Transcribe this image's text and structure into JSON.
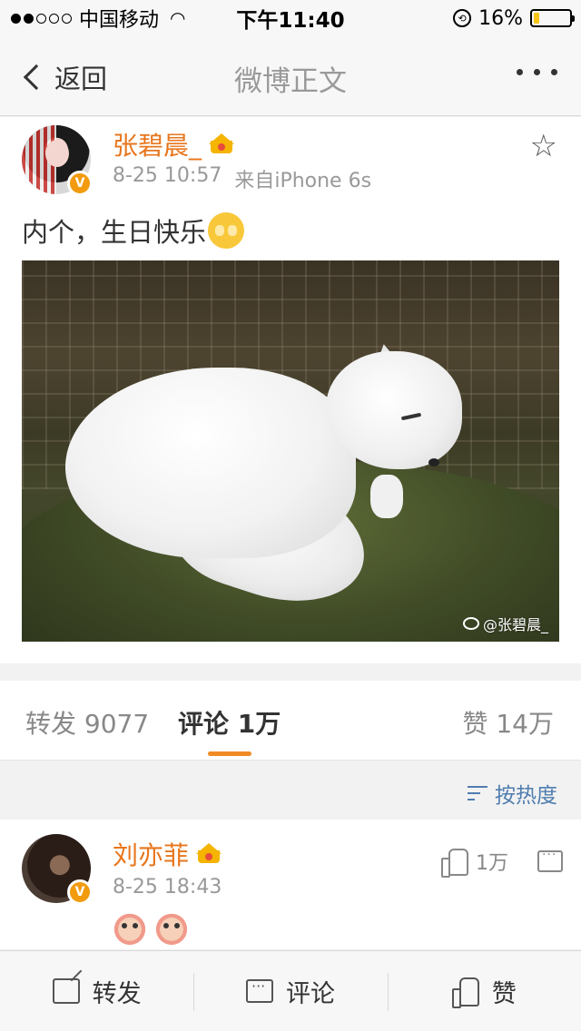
{
  "status_bar": {
    "carrier": "中国移动",
    "time": "下午11:40",
    "battery": "16%",
    "battery_level": 0.16
  },
  "nav": {
    "back_label": "返回",
    "title": "微博正文"
  },
  "post": {
    "author": "张碧晨_",
    "time": "8-25 10:57",
    "source": "来自iPhone 6s",
    "text": "内个，生日快乐",
    "watermark": "@张碧晨_"
  },
  "tabs": {
    "repost_label": "转发",
    "repost_count": "9077",
    "comments_label": "评论",
    "comments_count": "1万",
    "likes_label": "赞",
    "likes_count": "14万"
  },
  "sort": {
    "label": "按热度"
  },
  "comment": {
    "author": "刘亦菲",
    "time": "8-25 18:43",
    "likes": "1万"
  },
  "bottom_bar": {
    "repost": "转发",
    "comment": "评论",
    "like": "赞"
  },
  "colors": {
    "username": "#e8761c",
    "accent": "#f08a24",
    "link": "#507daf",
    "verified": "#f29b0f"
  }
}
